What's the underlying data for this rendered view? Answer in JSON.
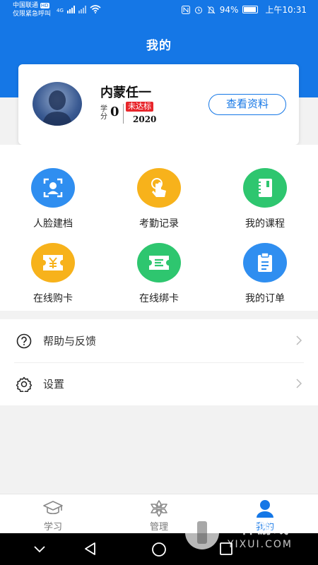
{
  "status_bar": {
    "carrier_line1": "中国联通",
    "carrier_badge": "HD",
    "carrier_line2": "仅限紧急呼叫",
    "network": "4G",
    "battery": "94%",
    "time": "上午10:31"
  },
  "header": {
    "title": "我的"
  },
  "profile": {
    "name": "内蒙任一",
    "credit_label": "学分",
    "credit_value": "0",
    "status_badge": "未达标",
    "year": "2020",
    "view_button": "查看资料"
  },
  "grid": [
    {
      "label": "人脸建档",
      "icon": "face-scan-icon",
      "color": "#2f8ef0"
    },
    {
      "label": "考勤记录",
      "icon": "tap-hand-icon",
      "color": "#f7b21b"
    },
    {
      "label": "我的课程",
      "icon": "notebook-icon",
      "color": "#2ec66f"
    },
    {
      "label": "在线购卡",
      "icon": "yen-ticket-icon",
      "color": "#f7b21b"
    },
    {
      "label": "在线绑卡",
      "icon": "ticket-icon",
      "color": "#2ec66f"
    },
    {
      "label": "我的订单",
      "icon": "clipboard-icon",
      "color": "#2f8ef0"
    }
  ],
  "list": [
    {
      "label": "帮助与反馈",
      "icon": "help-icon"
    },
    {
      "label": "设置",
      "icon": "settings-icon"
    }
  ],
  "tabs": [
    {
      "label": "学习",
      "icon": "graduation-cap-icon"
    },
    {
      "label": "管理",
      "icon": "snowflake-icon"
    },
    {
      "label": "我的",
      "icon": "person-icon",
      "active": true
    }
  ],
  "watermark": {
    "text": "一件游戏",
    "sub": "YIXUI.COM"
  },
  "colors": {
    "primary": "#1577e6",
    "danger": "#e8262b"
  }
}
